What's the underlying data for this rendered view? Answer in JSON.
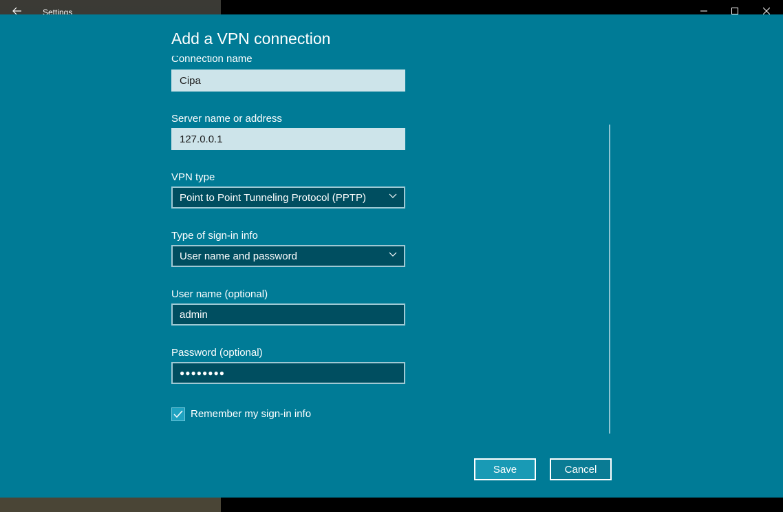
{
  "window": {
    "title": "Settings",
    "back_icon": "arrow-left-icon",
    "minimize_icon": "minimize-icon",
    "maximize_icon": "maximize-icon",
    "close_icon": "close-icon"
  },
  "dialog": {
    "title": "Add a VPN connection",
    "fields": {
      "connection_name": {
        "label": "Connection name",
        "value": "Cipa"
      },
      "server": {
        "label": "Server name or address",
        "value": "127.0.0.1"
      },
      "vpn_type": {
        "label": "VPN type",
        "value": "Point to Point Tunneling Protocol (PPTP)"
      },
      "signin_type": {
        "label": "Type of sign-in info",
        "value": "User name and password"
      },
      "username": {
        "label": "User name (optional)",
        "value": "admin"
      },
      "password": {
        "label": "Password (optional)",
        "value": "●●●●●●●●"
      }
    },
    "remember": {
      "label": "Remember my sign-in info",
      "checked": true
    },
    "buttons": {
      "save": "Save",
      "cancel": "Cancel"
    }
  },
  "colors": {
    "dialog_bg": "#007b96",
    "input_light": "#cde4ea",
    "input_dark": "#004e60",
    "save_bg": "#199ab5"
  }
}
